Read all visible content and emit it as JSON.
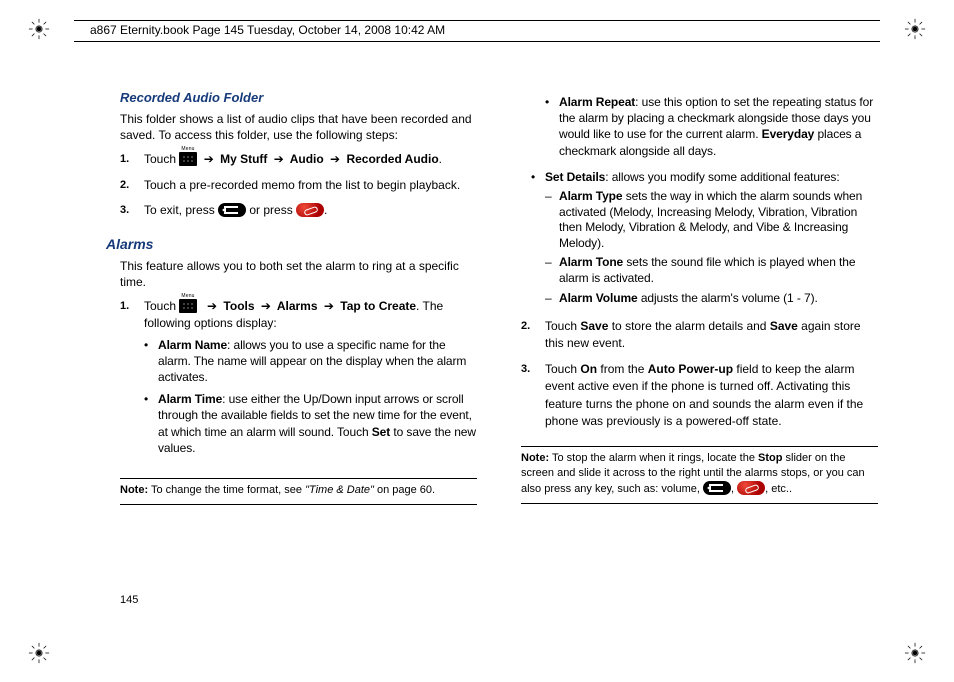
{
  "header": {
    "text": "a867 Eternity.book  Page 145  Tuesday, October 14, 2008  10:42 AM"
  },
  "pageNumber": "145",
  "left": {
    "h1": "Recorded Audio Folder",
    "intro": "This folder shows a list of audio clips that have been recorded and saved. To access this folder, use the following steps:",
    "step1_touch": "Touch ",
    "step1_trail1": " My Stuff ",
    "step1_trail2": " Audio ",
    "step1_trail3": " Recorded Audio",
    "step2": "Touch a pre-recorded memo from the list to begin playback.",
    "step3_a": "To exit, press ",
    "step3_b": " or press ",
    "h2": "Alarms",
    "alarms_intro": "This feature allows you to both set the alarm to ring at a specific time.",
    "a1_touch": "Touch ",
    "a1_tools": " Tools ",
    "a1_alarms": " Alarms ",
    "a1_tap1": " Tap to Create",
    "a1_tap2": ". The following options display:",
    "a1_b1_name": "Alarm Name",
    "a1_b1_text": ": allows you to use a specific name for the alarm. The name will appear on the display when the alarm activates.",
    "a1_b2_name": "Alarm Time",
    "a1_b2_text": ": use either the Up/Down input arrows or scroll through the available fields to set the new time for the event, at which time an alarm will sound. Touch ",
    "a1_b2_set": "Set",
    "a1_b2_tail": " to save the new values.",
    "note1_a": "Note:",
    "note1_b": " To change the time format, see ",
    "note1_i": "\"Time & Date\"",
    "note1_c": " on page 60."
  },
  "right": {
    "r_b1_name": "Alarm Repeat",
    "r_b1_text_a": ": use this option to set the repeating status for the alarm by placing a checkmark alongside those days you would like to use for the current alarm. ",
    "r_b1_everyday": "Everyday",
    "r_b1_text_b": " places a checkmark alongside all days.",
    "r_b2_name": "Set Details",
    "r_b2_text": ": allows you modify some additional features:",
    "r_d1_name": "Alarm Type",
    "r_d1_text": " sets the way in which the alarm sounds when activated (Melody, Increasing Melody, Vibration, Vibration then Melody, Vibration & Melody, and Vibe & Increasing Melody).",
    "r_d2_name": "Alarm Tone",
    "r_d2_text": " sets the sound file which is played when the alarm is activated.",
    "r_d3_name": "Alarm Volume",
    "r_d3_text": " adjusts the alarm's volume (1 - 7).",
    "r_s2_a": "Touch ",
    "r_s2_save": "Save",
    "r_s2_b": " to store the alarm details and ",
    "r_s2_c": " again store this new event.",
    "r_s3_a": "Touch ",
    "r_s3_on": "On",
    "r_s3_b": " from the ",
    "r_s3_apu": "Auto Power-up",
    "r_s3_c": " field to keep the alarm event active even if the phone is turned off. Activating this feature turns the phone on and sounds the alarm even if the phone was previously is a powered-off state.",
    "note2_a": "Note:",
    "note2_b": " To stop the alarm when it rings, locate the ",
    "note2_stop": "Stop",
    "note2_c": " slider on the screen and slide it across to the right until the alarms stops, or you can also press any key, such as: volume, ",
    "note2_d": ", ",
    "note2_e": ", etc.."
  }
}
